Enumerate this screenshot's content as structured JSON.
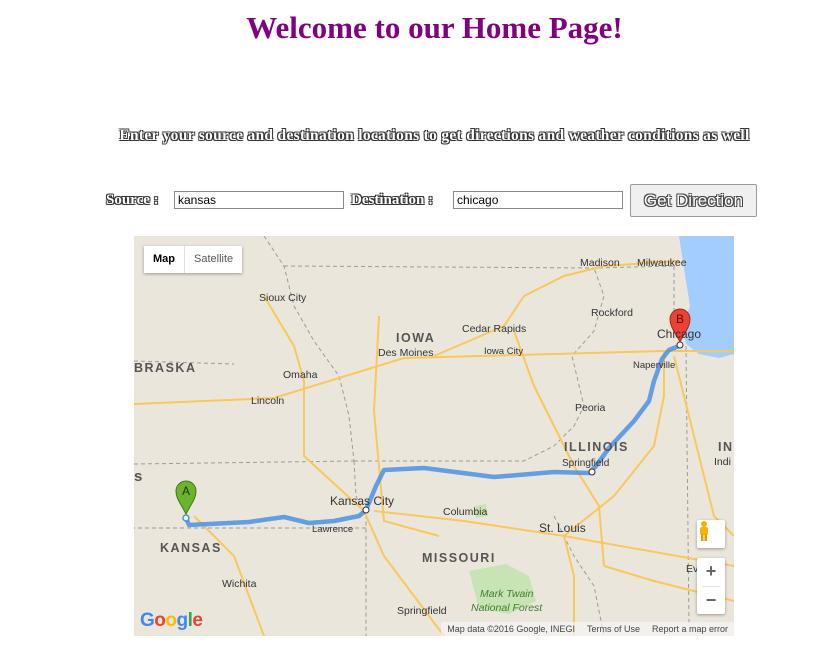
{
  "page": {
    "title": "Welcome to our Home Page!",
    "subtitle": "Enter your source and destination locations to get directions and weather conditions as well"
  },
  "form": {
    "source_label": "Source :",
    "source_value": "kansas",
    "destination_label": "Destination :",
    "destination_value": "chicago",
    "button_label": "Get Direction"
  },
  "map": {
    "type_control": {
      "map": "Map",
      "satellite": "Satellite"
    },
    "zoom_in": "+",
    "zoom_out": "−",
    "markers": {
      "a": "A",
      "b": "B"
    },
    "logo": "Google",
    "attribution": {
      "data": "Map data ©2016 Google, INEGI",
      "terms": "Terms of Use",
      "report": "Report a map error"
    },
    "labels": {
      "madison": "Madison",
      "milwaukee": "Milwaukee",
      "sioux_city": "Sioux City",
      "iowa": "IOWA",
      "cedar_rapids": "Cedar Rapids",
      "rockford": "Rockford",
      "chicago": "Chicago",
      "des_moines": "Des Moines",
      "iowa_city": "Iowa City",
      "naperville": "Naperville",
      "nebraska": "BRASKA",
      "omaha": "Omaha",
      "lincoln": "Lincoln",
      "peoria": "Peoria",
      "illinois": "ILLINOIS",
      "springfield_il": "Springfield",
      "in_state": "IN",
      "indianapolis": "Indi",
      "kansas_city": "Kansas City",
      "lawrence": "Lawrence",
      "columbia": "Columbia",
      "st_louis": "St. Louis",
      "kansas": "KANSAS",
      "missouri": "MISSOURI",
      "wichita": "Wichita",
      "evansville": "Evansv",
      "mark_twain": "Mark Twain",
      "national_forest": "National Forest",
      "springfield_mo": "Springfield",
      "s_partial": "s"
    },
    "colors": {
      "route": "#4a90e2",
      "water": "#a3ccff",
      "marker_a": "#6ab42f",
      "marker_b": "#ea4335"
    }
  }
}
